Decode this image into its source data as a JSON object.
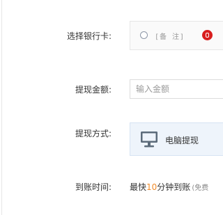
{
  "form": {
    "bank_card": {
      "label": "选择银行卡:",
      "option_remark": "[备 注]",
      "bank_icon": "bank-logo-icon",
      "selected": false
    },
    "amount": {
      "label": "提现金额:",
      "placeholder": "输入金额",
      "value": ""
    },
    "method": {
      "label": "提现方式:",
      "option_label": "电脑提现",
      "option_icon": "monitor-icon"
    },
    "arrival_time": {
      "label": "到账时间:",
      "prefix": "最快",
      "number": "10",
      "suffix": "分钟到账",
      "note": "(免费"
    }
  },
  "colors": {
    "highlight": "#f08c2c",
    "bank_brand": "#d81e1e",
    "method_bg": "#eef4fb",
    "icon": "#5c6b7a"
  }
}
